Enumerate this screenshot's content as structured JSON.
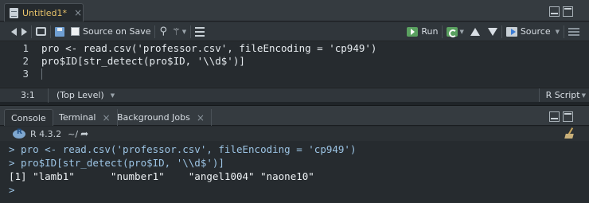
{
  "editor": {
    "tab": {
      "title": "Untitled1*",
      "close": "×"
    },
    "toolbar": {
      "source_on_save_label": "Source on Save",
      "run_label": "Run",
      "source_label": "Source"
    },
    "line_numbers": [
      "1",
      "2",
      "3"
    ],
    "code": [
      "pro <- read.csv('professor.csv', fileEncoding = 'cp949')",
      "pro$ID[str_detect(pro$ID, '\\\\d$')]",
      ""
    ],
    "status": {
      "position": "3:1",
      "scope": "(Top Level)",
      "filetype": "R Script"
    }
  },
  "console": {
    "tabs": [
      {
        "label": "Console",
        "closable": false
      },
      {
        "label": "Terminal",
        "closable": true
      },
      {
        "label": "Background Jobs",
        "closable": true
      }
    ],
    "close": "×",
    "r_version": "R 4.3.2",
    "working_dir": "~/",
    "lines": [
      "> pro <- read.csv('professor.csv', fileEncoding = 'cp949')",
      "> pro$ID[str_detect(pro$ID, '\\\\d$')]",
      "[1] \"lamb1\"      \"number1\"    \"angel1004\" \"naone10\"  ",
      "> "
    ]
  },
  "colors": {
    "background": "#262b2f",
    "panel": "#353b40",
    "console_command": "#9cc4e4",
    "modified_tab": "#e8c36a",
    "run_green": "#5aa160"
  }
}
